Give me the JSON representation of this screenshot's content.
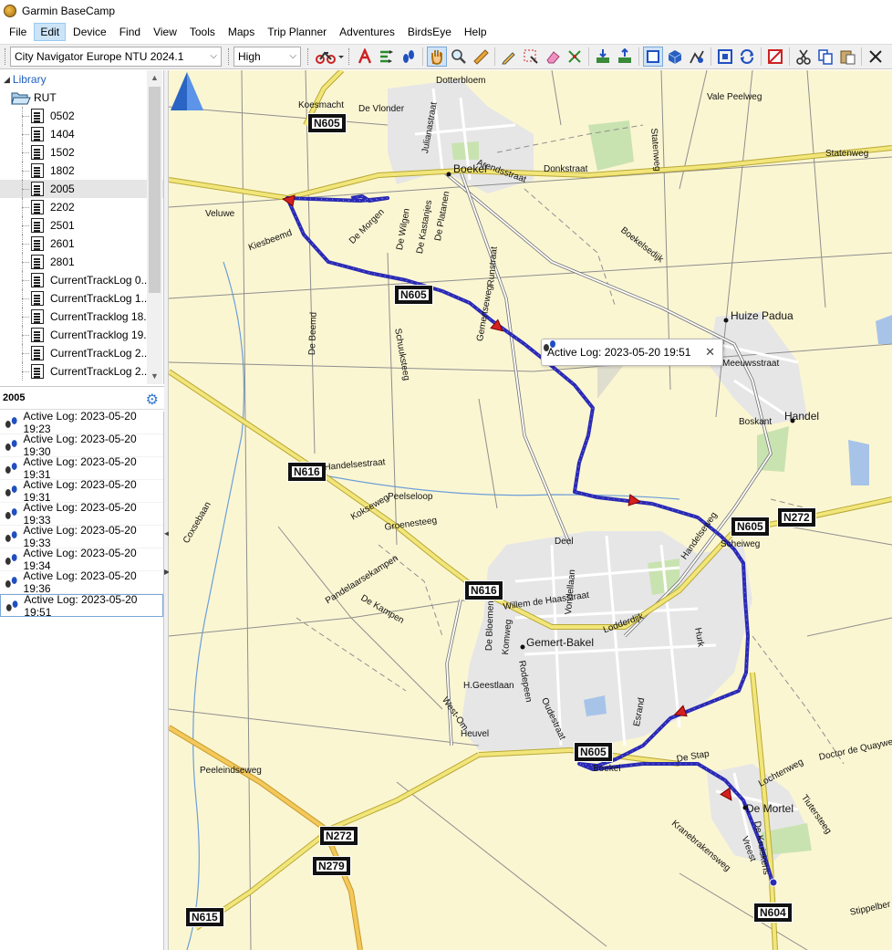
{
  "window": {
    "title": "Garmin BaseCamp"
  },
  "menu": [
    "File",
    "Edit",
    "Device",
    "Find",
    "View",
    "Tools",
    "Maps",
    "Trip Planner",
    "Adventures",
    "BirdsEye",
    "Help"
  ],
  "menu_active": "Edit",
  "toolbar": {
    "map_product": "City Navigator Europe NTU 2024.1",
    "detail_level": "High"
  },
  "library": {
    "header": "Library",
    "root": "RUT",
    "items": [
      "0502",
      "1404",
      "1502",
      "1802",
      "2005",
      "2202",
      "2501",
      "2601",
      "2801",
      "CurrentTrackLog 0...",
      "CurrentTrackLog 1...",
      "CurrentTracklog 18...",
      "CurrentTracklog 19...",
      "CurrentTrackLog 2...",
      "CurrentTrackLog 2..."
    ],
    "selected": "2005"
  },
  "list": {
    "title": "2005",
    "items": [
      "Active Log: 2023-05-20 19:23",
      "Active Log: 2023-05-20 19:30",
      "Active Log: 2023-05-20 19:31",
      "Active Log: 2023-05-20 19:31",
      "Active Log: 2023-05-20 19:33",
      "Active Log: 2023-05-20 19:33",
      "Active Log: 2023-05-20 19:34",
      "Active Log: 2023-05-20 19:36",
      "Active Log: 2023-05-20 19:51"
    ],
    "selected_index": 8
  },
  "map": {
    "callout": "Active Log: 2023-05-20 19:51",
    "shields": [
      "N605",
      "N605",
      "N616",
      "N605",
      "N272",
      "N616",
      "N272",
      "N279",
      "N604",
      "N615",
      "N605"
    ],
    "towns": [
      "Boekel",
      "Huize Padua",
      "Handel",
      "Gemert-Bakel",
      "De Mortel"
    ],
    "labels": [
      "Koesmacht",
      "De Vlonder",
      "Dotterbloem",
      "Julianastraat",
      "Donkstraat",
      "Arendsstraat",
      "Vale Peelweg",
      "Statenweg",
      "Statenweg",
      "Veluwe",
      "Kiesbeemd",
      "De Morgen",
      "De Wilgen",
      "De Kastanjes",
      "De Platanen",
      "Runstraat",
      "Boekelsedijk",
      "Gemertseweg",
      "Schuuksteeg",
      "De Beemd",
      "Meeuwsstraat",
      "Boskant",
      "Handelsestraat",
      "Peelseloop",
      "Groenesteeg",
      "Kokseweg",
      "Coxsebaan",
      "Pandelaarsekampen",
      "De Kampen",
      "Deel",
      "Vondellaan",
      "Willem de Haasstraat",
      "Lodderdijk",
      "Handelseweg",
      "Scheiweg",
      "Hurk",
      "De Bloemen",
      "Komweg",
      "H.Geestlaan",
      "Rodepeen",
      "Oudestraat",
      "Esrand",
      "West-Om",
      "Heuvel",
      "Peeleindseweg",
      "Boekel",
      "De Stap",
      "Lochtenweg",
      "Doctor de Quaywe",
      "Tiutersteeg",
      "Kranebrakensweg",
      "Vreest",
      "Stippelber",
      "De Kruiskens"
    ]
  },
  "colors": {
    "track": "#2a2ab4",
    "map_bg": "#fbf6d2",
    "accent": "#1f5fbf"
  }
}
